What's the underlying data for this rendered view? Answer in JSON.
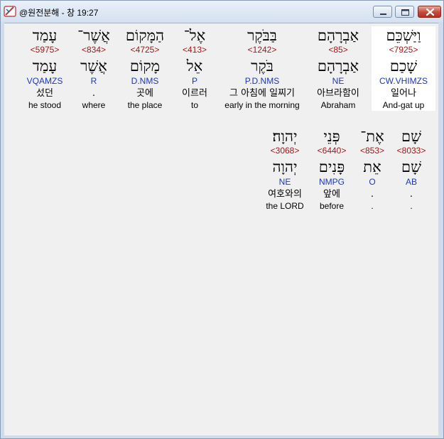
{
  "window": {
    "title": "@원전분해 - 창 19:27"
  },
  "colors": {
    "strong": "#a01818",
    "morph": "#1f36b8",
    "highlight": "#ffffff"
  },
  "words": [
    {
      "hebrew": "וַיַּשְׁכֵּם",
      "strong": "<7925>",
      "lemma": "שָׁכַם",
      "morph": "CW.VHIMZS",
      "korean": "일어나",
      "english": "And-gat up"
    },
    {
      "hebrew": "אַבְרָהָם",
      "strong": "<85>",
      "lemma": "אַבְרָהָם",
      "morph": "NE",
      "korean": "아브라함이",
      "english": "Abraham"
    },
    {
      "hebrew": "בַּבֹּקֶר",
      "strong": "<1242>",
      "lemma": "בֹּקֶר",
      "morph": "P.D.NMS",
      "korean": "그 아침에 일찌기",
      "english": "early in the morning"
    },
    {
      "hebrew": "אֶל־",
      "strong": "<413>",
      "lemma": "אֵל",
      "morph": "P",
      "korean": "이르러",
      "english": "to"
    },
    {
      "hebrew": "הַמָּקוֹם",
      "strong": "<4725>",
      "lemma": "מָקוֹם",
      "morph": "D.NMS",
      "korean": "곳에",
      "english": "the place"
    },
    {
      "hebrew": "אֲשֶׁר־",
      "strong": "<834>",
      "lemma": "אֲשֶׁר",
      "morph": "R",
      "korean": ".",
      "english": "where"
    },
    {
      "hebrew": "עָמַד",
      "strong": "<5975>",
      "lemma": "עָמַד",
      "morph": "VQAMZS",
      "korean": "섰던",
      "english": "he stood"
    },
    {
      "hebrew": "שָׁם",
      "strong": "<8033>",
      "lemma": "שָׁם",
      "morph": "AB",
      "korean": ".",
      "english": "."
    },
    {
      "hebrew": "אֶת־",
      "strong": "<853>",
      "lemma": "אֵת",
      "morph": "O",
      "korean": ".",
      "english": "."
    },
    {
      "hebrew": "פְּנֵי",
      "strong": "<6440>",
      "lemma": "פָּנִים",
      "morph": "NMPG",
      "korean": "앞에",
      "english": "before"
    },
    {
      "hebrew": "יְהוָה׃",
      "strong": "<3068>",
      "lemma": "יְהוָה",
      "morph": "NE",
      "korean": "여호와의",
      "english": "the LORD"
    }
  ]
}
